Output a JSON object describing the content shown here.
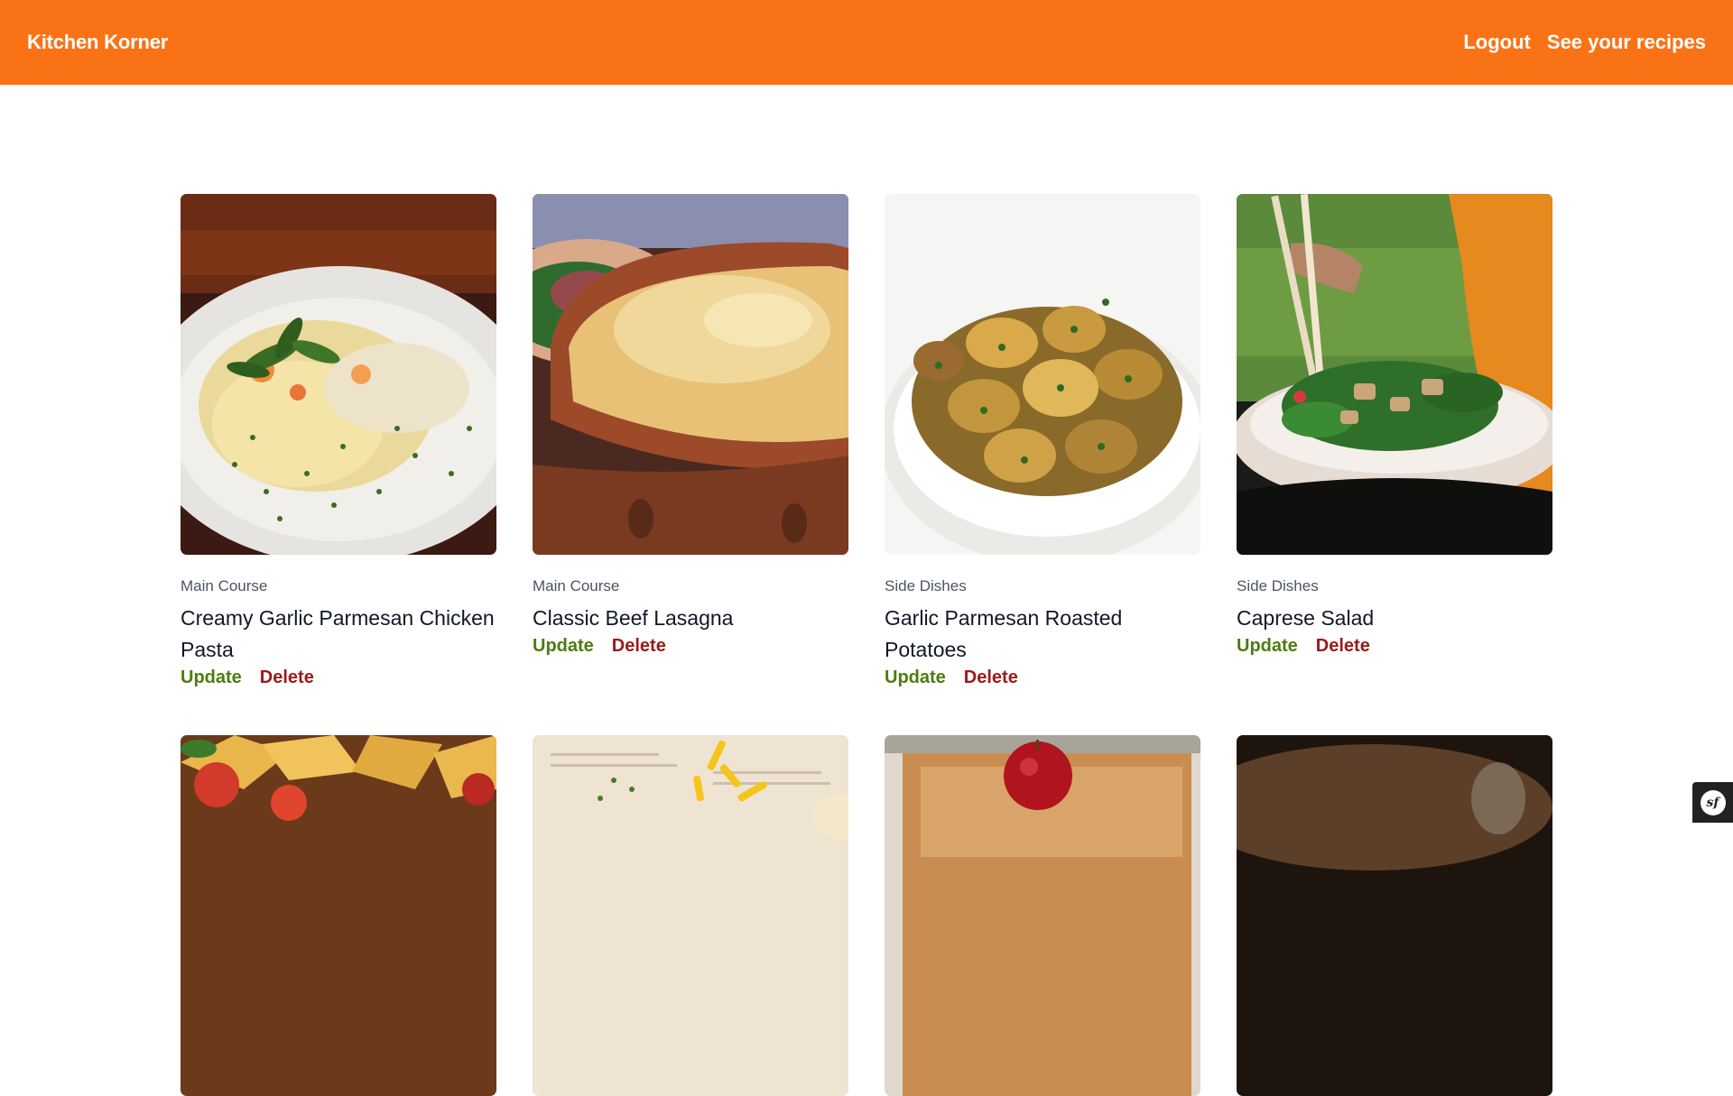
{
  "header": {
    "brand": "Kitchen Korner",
    "nav": {
      "logout": "Logout",
      "see_recipes": "See your recipes"
    },
    "color": "#f97316"
  },
  "recipes": [
    {
      "category": "Main Course",
      "title": "Creamy Garlic Parmesan Chicken Pasta",
      "update": "Update",
      "delete": "Delete"
    },
    {
      "category": "Main Course",
      "title": "Classic Beef Lasagna",
      "update": "Update",
      "delete": "Delete"
    },
    {
      "category": "Side Dishes",
      "title": "Garlic Parmesan Roasted Potatoes",
      "update": "Update",
      "delete": "Delete"
    },
    {
      "category": "Side Dishes",
      "title": "Caprese Salad",
      "update": "Update",
      "delete": "Delete"
    }
  ],
  "colors": {
    "update": "#4d7c0f",
    "delete": "#991b1b"
  },
  "debug_toolbar": {
    "icon": "symfony-icon",
    "glyph": "sf"
  }
}
